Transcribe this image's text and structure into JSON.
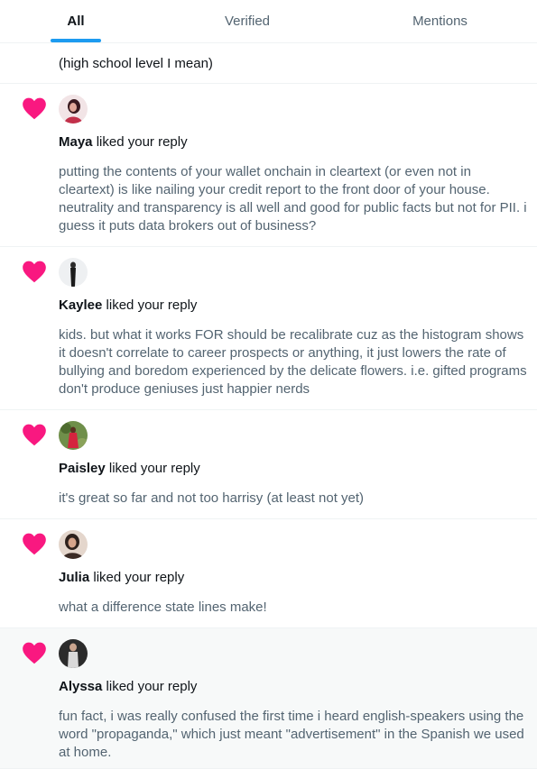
{
  "tabs": [
    {
      "label": "All",
      "active": true
    },
    {
      "label": "Verified",
      "active": false
    },
    {
      "label": "Mentions",
      "active": false
    }
  ],
  "partial_text": "(high school level I mean)",
  "liked_suffix": "liked your reply",
  "colors": {
    "heart": "#f91880",
    "accent": "#1d9bf0",
    "divider": "#eff3f4",
    "secondary_text": "#536471"
  },
  "notifications": [
    {
      "name": "Maya",
      "text": "putting the contents of your wallet onchain in cleartext (or even not in cleartext) is like nailing your credit report to the front door of your house. neutrality and transparency is all well and good for public facts but not for PII. i guess it puts data brokers out of business?"
    },
    {
      "name": "Kaylee",
      "text": "kids. but what it works FOR should be recalibrate cuz as the histogram shows it doesn't correlate to career prospects or anything, it just lowers the rate of bullying and boredom experienced by the delicate flowers. i.e. gifted programs don't produce geniuses just happier nerds"
    },
    {
      "name": "Paisley",
      "text": "it's great so far and not too harrisy (at least not yet)"
    },
    {
      "name": "Julia",
      "text": "what a difference state lines make!"
    },
    {
      "name": "Alyssa",
      "text": "fun fact, i was really confused the first time i heard english-speakers using the word \"propaganda,\" which just meant \"advertisement\" in the Spanish we used at home."
    }
  ]
}
